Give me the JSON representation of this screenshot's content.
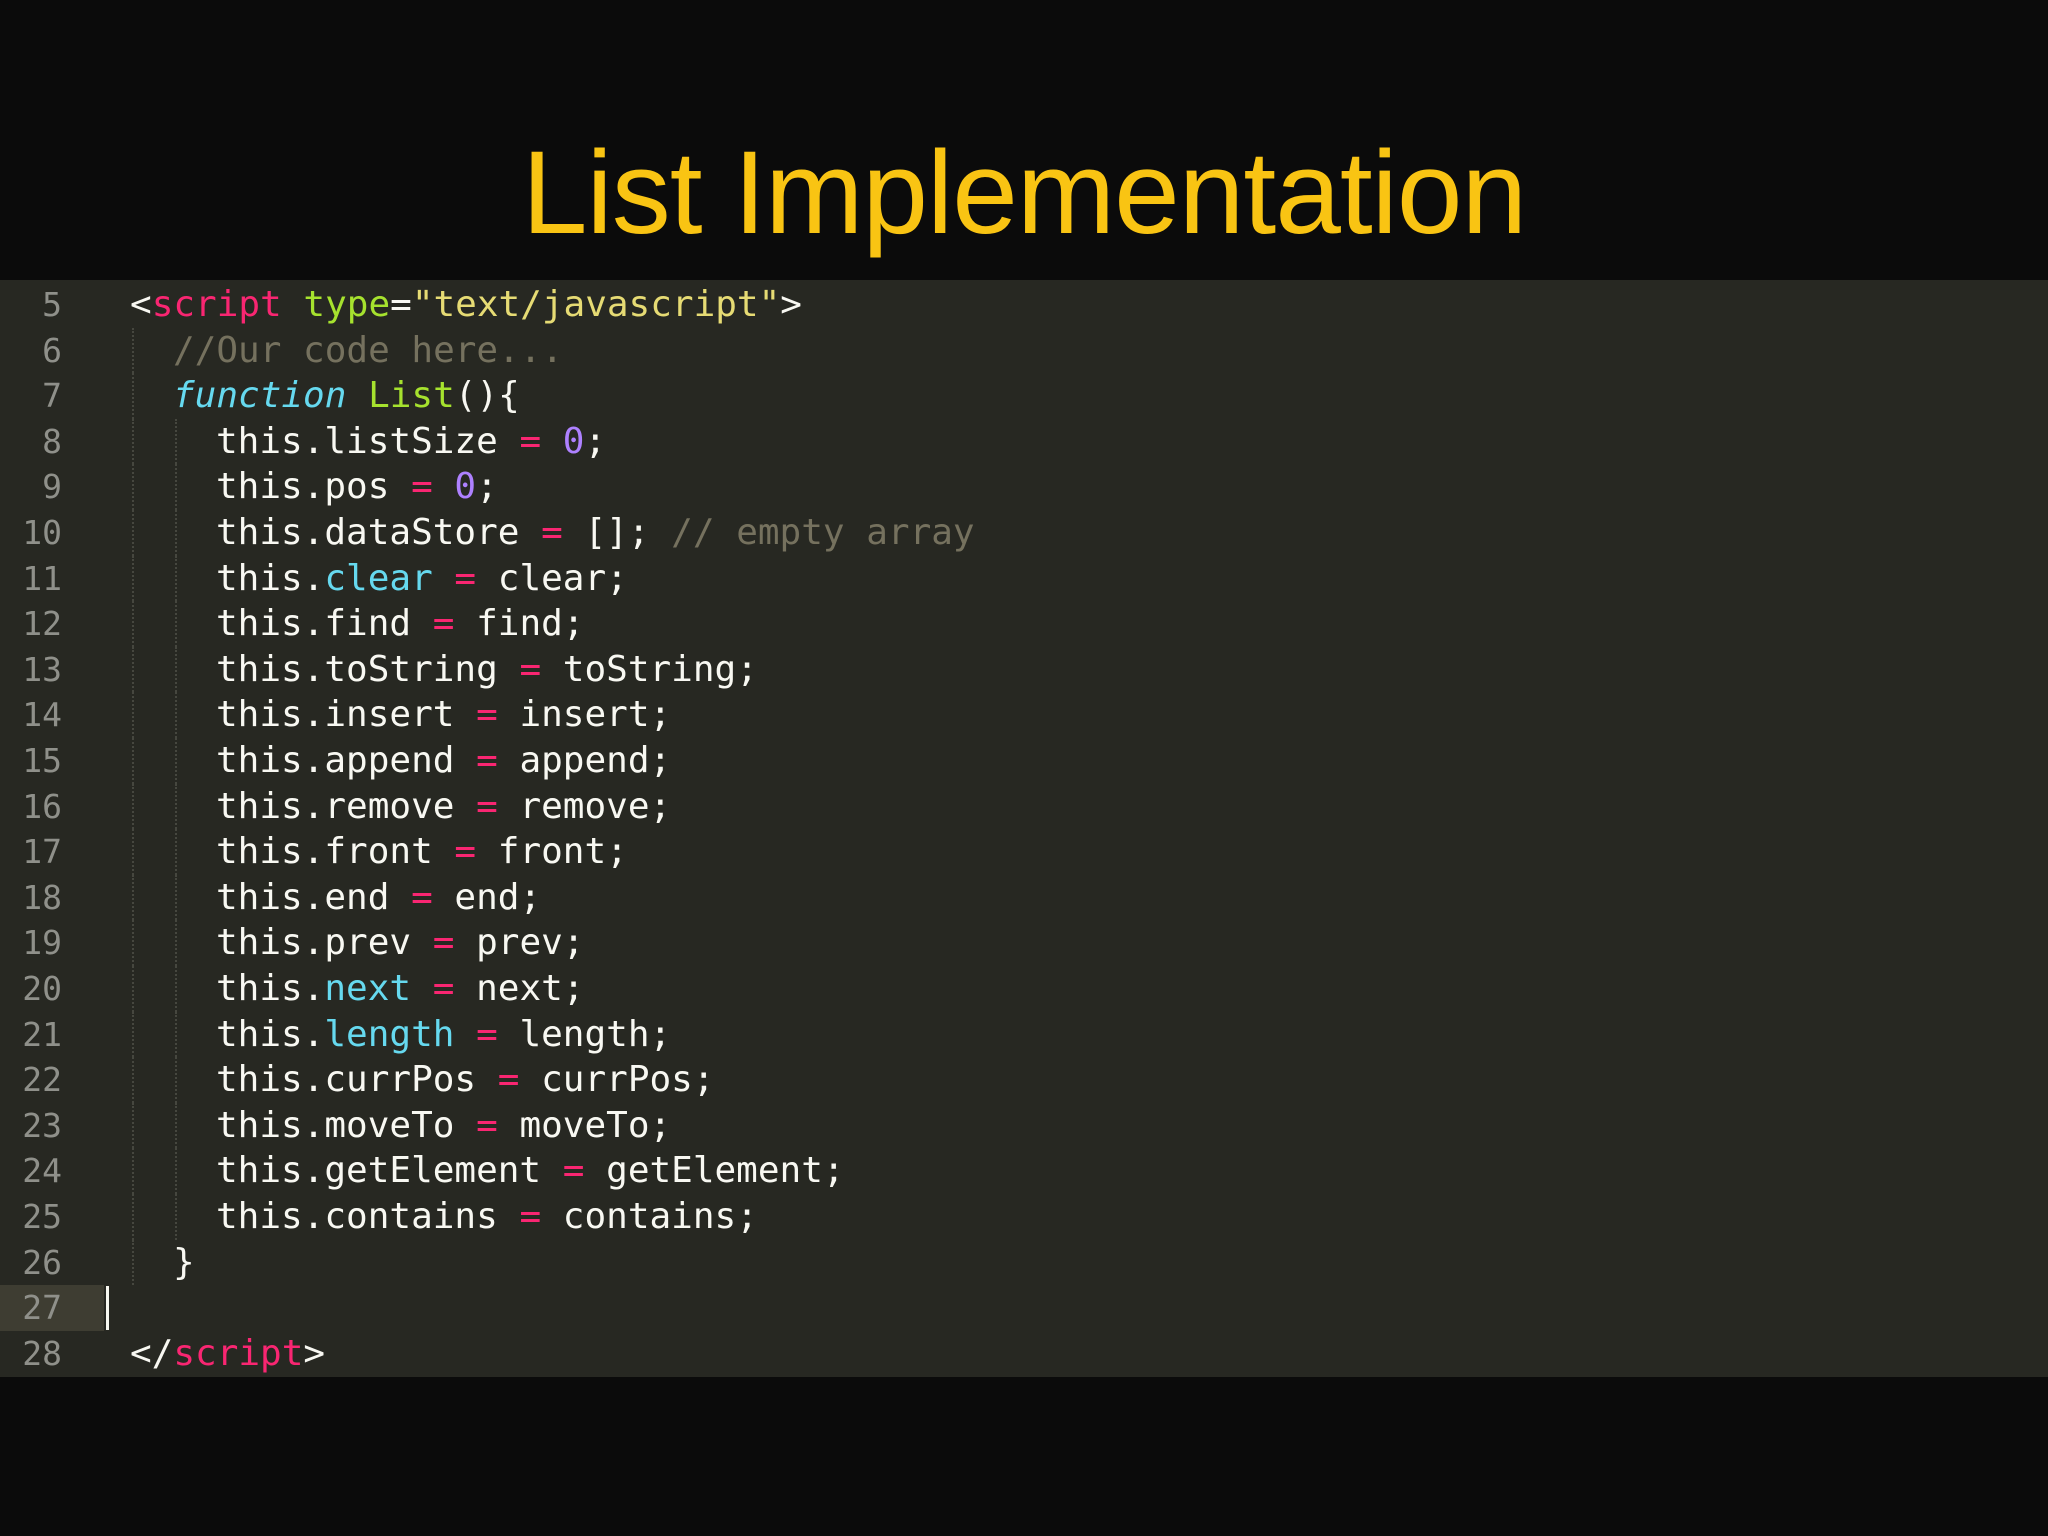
{
  "slide": {
    "title": "List Implementation"
  },
  "editor": {
    "active_line": 27,
    "colors": {
      "background": "#272822",
      "tag": "#f92672",
      "attribute": "#a6e22e",
      "string": "#e6db74",
      "comment": "#75715e",
      "keyword": "#66d9ef",
      "number": "#ae81ff",
      "default": "#f8f8f2",
      "title": "#f9c413"
    },
    "lines": [
      {
        "number": "5",
        "indent": 0,
        "tokens": [
          {
            "t": "<",
            "c": "punct"
          },
          {
            "t": "script",
            "c": "tag"
          },
          {
            "t": " ",
            "c": "plain"
          },
          {
            "t": "type",
            "c": "attr"
          },
          {
            "t": "=",
            "c": "punct"
          },
          {
            "t": "\"text/javascript\"",
            "c": "str"
          },
          {
            "t": ">",
            "c": "punct"
          }
        ]
      },
      {
        "number": "6",
        "indent": 1,
        "tokens": [
          {
            "t": "//Our code here...",
            "c": "comment"
          }
        ]
      },
      {
        "number": "7",
        "indent": 1,
        "tokens": [
          {
            "t": "function",
            "c": "keyword"
          },
          {
            "t": " ",
            "c": "plain"
          },
          {
            "t": "List",
            "c": "fname"
          },
          {
            "t": "(){",
            "c": "plain"
          }
        ]
      },
      {
        "number": "8",
        "indent": 2,
        "tokens": [
          {
            "t": "this.listSize",
            "c": "plain"
          },
          {
            "t": " = ",
            "c": "op"
          },
          {
            "t": "0",
            "c": "num"
          },
          {
            "t": ";",
            "c": "plain"
          }
        ]
      },
      {
        "number": "9",
        "indent": 2,
        "tokens": [
          {
            "t": "this.pos",
            "c": "plain"
          },
          {
            "t": " = ",
            "c": "op"
          },
          {
            "t": "0",
            "c": "num"
          },
          {
            "t": ";",
            "c": "plain"
          }
        ]
      },
      {
        "number": "10",
        "indent": 2,
        "tokens": [
          {
            "t": "this.dataStore",
            "c": "plain"
          },
          {
            "t": " = ",
            "c": "op"
          },
          {
            "t": "[]; ",
            "c": "plain"
          },
          {
            "t": "// empty array",
            "c": "comment"
          }
        ]
      },
      {
        "number": "11",
        "indent": 2,
        "tokens": [
          {
            "t": "this.",
            "c": "plain"
          },
          {
            "t": "clear",
            "c": "prop"
          },
          {
            "t": " = ",
            "c": "op"
          },
          {
            "t": "clear;",
            "c": "plain"
          }
        ]
      },
      {
        "number": "12",
        "indent": 2,
        "tokens": [
          {
            "t": "this.find",
            "c": "plain"
          },
          {
            "t": " = ",
            "c": "op"
          },
          {
            "t": "find;",
            "c": "plain"
          }
        ]
      },
      {
        "number": "13",
        "indent": 2,
        "tokens": [
          {
            "t": "this.toString",
            "c": "plain"
          },
          {
            "t": " = ",
            "c": "op"
          },
          {
            "t": "toString;",
            "c": "plain"
          }
        ]
      },
      {
        "number": "14",
        "indent": 2,
        "tokens": [
          {
            "t": "this.insert",
            "c": "plain"
          },
          {
            "t": " = ",
            "c": "op"
          },
          {
            "t": "insert;",
            "c": "plain"
          }
        ]
      },
      {
        "number": "15",
        "indent": 2,
        "tokens": [
          {
            "t": "this.append",
            "c": "plain"
          },
          {
            "t": " = ",
            "c": "op"
          },
          {
            "t": "append;",
            "c": "plain"
          }
        ]
      },
      {
        "number": "16",
        "indent": 2,
        "tokens": [
          {
            "t": "this.remove",
            "c": "plain"
          },
          {
            "t": " = ",
            "c": "op"
          },
          {
            "t": "remove;",
            "c": "plain"
          }
        ]
      },
      {
        "number": "17",
        "indent": 2,
        "tokens": [
          {
            "t": "this.front",
            "c": "plain"
          },
          {
            "t": " = ",
            "c": "op"
          },
          {
            "t": "front;",
            "c": "plain"
          }
        ]
      },
      {
        "number": "18",
        "indent": 2,
        "tokens": [
          {
            "t": "this.end",
            "c": "plain"
          },
          {
            "t": " = ",
            "c": "op"
          },
          {
            "t": "end;",
            "c": "plain"
          }
        ]
      },
      {
        "number": "19",
        "indent": 2,
        "tokens": [
          {
            "t": "this.prev",
            "c": "plain"
          },
          {
            "t": " = ",
            "c": "op"
          },
          {
            "t": "prev;",
            "c": "plain"
          }
        ]
      },
      {
        "number": "20",
        "indent": 2,
        "tokens": [
          {
            "t": "this.",
            "c": "plain"
          },
          {
            "t": "next",
            "c": "prop"
          },
          {
            "t": " = ",
            "c": "op"
          },
          {
            "t": "next;",
            "c": "plain"
          }
        ]
      },
      {
        "number": "21",
        "indent": 2,
        "tokens": [
          {
            "t": "this.",
            "c": "plain"
          },
          {
            "t": "length",
            "c": "prop"
          },
          {
            "t": " = ",
            "c": "op"
          },
          {
            "t": "length;",
            "c": "plain"
          }
        ]
      },
      {
        "number": "22",
        "indent": 2,
        "tokens": [
          {
            "t": "this.currPos",
            "c": "plain"
          },
          {
            "t": " = ",
            "c": "op"
          },
          {
            "t": "currPos;",
            "c": "plain"
          }
        ]
      },
      {
        "number": "23",
        "indent": 2,
        "tokens": [
          {
            "t": "this.moveTo",
            "c": "plain"
          },
          {
            "t": " = ",
            "c": "op"
          },
          {
            "t": "moveTo;",
            "c": "plain"
          }
        ]
      },
      {
        "number": "24",
        "indent": 2,
        "tokens": [
          {
            "t": "this.getElement",
            "c": "plain"
          },
          {
            "t": " = ",
            "c": "op"
          },
          {
            "t": "getElement;",
            "c": "plain"
          }
        ]
      },
      {
        "number": "25",
        "indent": 2,
        "tokens": [
          {
            "t": "this.contains",
            "c": "plain"
          },
          {
            "t": " = ",
            "c": "op"
          },
          {
            "t": "contains;",
            "c": "plain"
          }
        ]
      },
      {
        "number": "26",
        "indent": 1,
        "tokens": [
          {
            "t": "}",
            "c": "plain"
          }
        ]
      },
      {
        "number": "27",
        "indent": 0,
        "tokens": []
      },
      {
        "number": "28",
        "indent": 0,
        "tokens": [
          {
            "t": "</",
            "c": "punct"
          },
          {
            "t": "script",
            "c": "tag"
          },
          {
            "t": ">",
            "c": "punct"
          }
        ]
      }
    ]
  }
}
